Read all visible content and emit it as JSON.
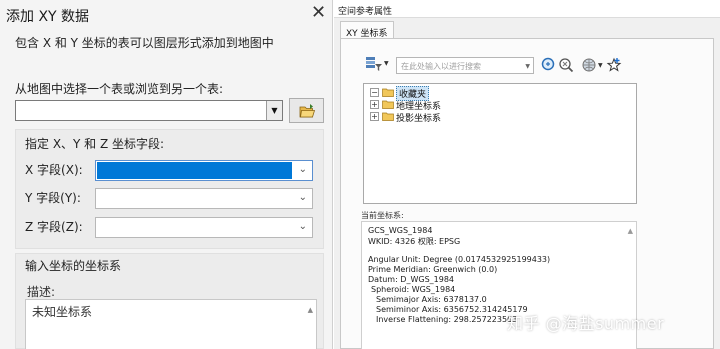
{
  "left_dialog": {
    "title": "添加 XY 数据",
    "description": "包含 X 和 Y 坐标的表可以图层形式添加到地图中",
    "choose_label": "从地图中选择一个表或浏览到另一个表:",
    "table_value": "",
    "fields_group_title": "指定 X、Y 和 Z 坐标字段:",
    "x_label": "X 字段(X):",
    "y_label": "Y 字段(Y):",
    "z_label": "Z 字段(Z):",
    "x_value": "",
    "y_value": "",
    "z_value": "",
    "crs_group_title": "输入坐标的坐标系",
    "crs_desc_label": "描述:",
    "crs_desc_value": "未知坐标系"
  },
  "right_dialog": {
    "title": "空间参考属性",
    "tab_label": "XY 坐标系",
    "search_placeholder": "在此处输入以进行搜索",
    "tree": [
      "收藏夹",
      "地理坐标系",
      "投影坐标系"
    ],
    "current_label": "当前坐标系:",
    "info_lines": [
      "GCS_WGS_1984",
      "WKID: 4326 权限: EPSG",
      "Angular Unit: Degree (0.0174532925199433)",
      "Prime Meridian: Greenwich (0.0)",
      "Datum: D_WGS_1984",
      "Spheroid: WGS_1984",
      "Semimajor Axis: 6378137.0",
      "Semiminor Axis: 6356752.314245179",
      "Inverse Flattening: 298.257223563"
    ]
  },
  "watermark": "知乎 @海盐summer",
  "colors": {
    "selection_blue": "#0078d7",
    "tree_highlight": "#cde4f7"
  },
  "icons": [
    "close-icon",
    "open-folder-icon",
    "filter-icon",
    "search-icon",
    "globe-icon",
    "add-favorite-icon",
    "folder-icon"
  ]
}
